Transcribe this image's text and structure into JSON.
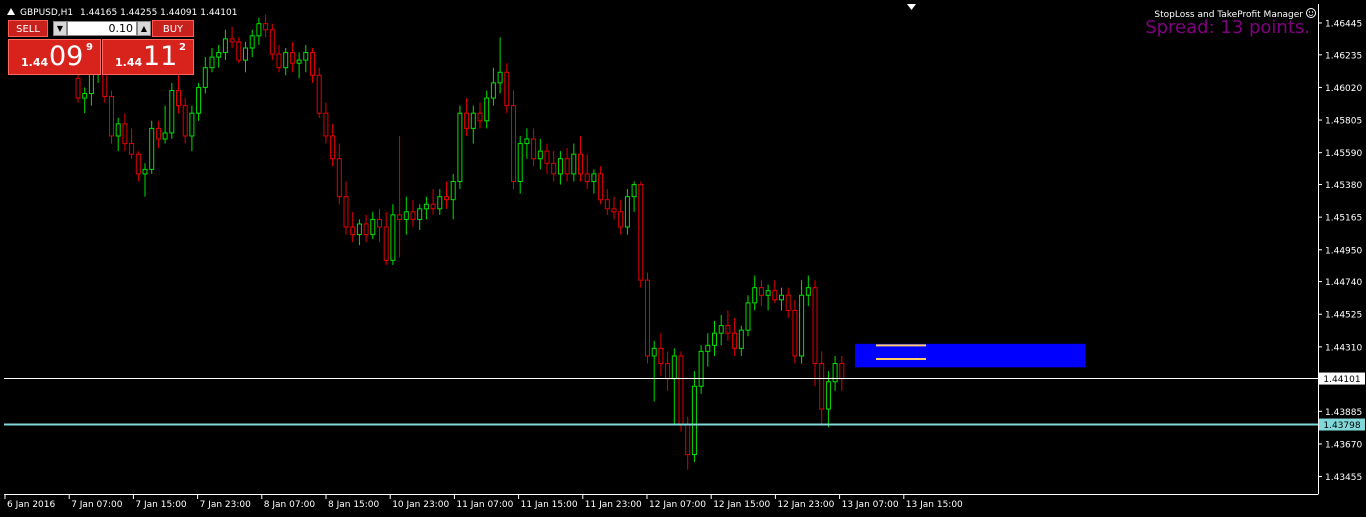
{
  "chart_header": {
    "symbol_tf": "GBPUSD,H1",
    "ohlc": "1.44165 1.44255 1.44091 1.44101",
    "collapse_icon": "triangle-up-icon",
    "shift_marker_icon": "triangle-down-icon"
  },
  "trade_panel": {
    "sell_label": "SELL",
    "buy_label": "BUY",
    "lot_value": "0.10",
    "lot_down_icon": "arrow-down-icon",
    "lot_up_icon": "arrow-up-icon",
    "sell_price_prefix": "1.44",
    "sell_price_big": "09",
    "sell_price_sup": "9",
    "buy_price_prefix": "1.44",
    "buy_price_big": "11",
    "buy_price_sup": "2"
  },
  "indicator": {
    "name": "StopLoss and TakeProfit Manager",
    "smiley_icon": "smiley-icon",
    "spread_text": "Spread: 13 points."
  },
  "price_axis": {
    "ticks": [
      "1.46445",
      "1.46235",
      "1.46020",
      "1.45805",
      "1.45590",
      "1.45380",
      "1.45165",
      "1.44950",
      "1.44740",
      "1.44525",
      "1.44310",
      "1.43885",
      "1.43670",
      "1.43455"
    ],
    "current_price_label": "1.44101",
    "line_price_label": "1.43798"
  },
  "time_axis": {
    "labels": [
      "6 Jan 2016",
      "7 Jan 07:00",
      "7 Jan 15:00",
      "7 Jan 23:00",
      "8 Jan 07:00",
      "8 Jan 15:00",
      "10 Jan 23:00",
      "11 Jan 07:00",
      "11 Jan 15:00",
      "11 Jan 23:00",
      "12 Jan 07:00",
      "12 Jan 15:00",
      "12 Jan 23:00",
      "13 Jan 07:00",
      "13 Jan 15:00"
    ]
  },
  "colors": {
    "background": "#000000",
    "bull": "#00e000",
    "bear": "#e00000",
    "axis": "#ffffff",
    "bid_line": "#ffffff",
    "level_line": "#80d8d8",
    "zone": "#0000ff",
    "sltp_line": "#ffcc66",
    "spread_text": "#800080"
  },
  "chart_data": {
    "type": "candlestick",
    "ylim": [
      1.4334,
      1.4657
    ],
    "zone": {
      "top": 1.4433,
      "bottom": 1.44175
    },
    "sltp_levels": [
      1.4432,
      1.4423
    ],
    "bid_line": 1.44101,
    "level_line": 1.43798,
    "candles": [
      [
        1.4608,
        1.4612,
        1.4592,
        1.4595
      ],
      [
        1.4595,
        1.4602,
        1.4585,
        1.4598
      ],
      [
        1.4598,
        1.462,
        1.459,
        1.4612
      ],
      [
        1.4612,
        1.4625,
        1.4605,
        1.4618
      ],
      [
        1.4618,
        1.463,
        1.4592,
        1.4596
      ],
      [
        1.4596,
        1.46,
        1.4565,
        1.457
      ],
      [
        1.457,
        1.4582,
        1.456,
        1.4578
      ],
      [
        1.4578,
        1.4585,
        1.456,
        1.4565
      ],
      [
        1.4565,
        1.4575,
        1.4555,
        1.4558
      ],
      [
        1.4558,
        1.456,
        1.454,
        1.4545
      ],
      [
        1.4545,
        1.4552,
        1.453,
        1.4548
      ],
      [
        1.4548,
        1.458,
        1.4545,
        1.4575
      ],
      [
        1.4575,
        1.458,
        1.4562,
        1.4568
      ],
      [
        1.4568,
        1.459,
        1.4565,
        1.4572
      ],
      [
        1.4572,
        1.4605,
        1.4568,
        1.46
      ],
      [
        1.46,
        1.462,
        1.4585,
        1.459
      ],
      [
        1.459,
        1.4595,
        1.4565,
        1.457
      ],
      [
        1.457,
        1.459,
        1.456,
        1.4585
      ],
      [
        1.4585,
        1.4605,
        1.458,
        1.4602
      ],
      [
        1.4602,
        1.4622,
        1.4598,
        1.4615
      ],
      [
        1.4615,
        1.4628,
        1.4612,
        1.4622
      ],
      [
        1.4622,
        1.463,
        1.4615,
        1.4625
      ],
      [
        1.4625,
        1.464,
        1.462,
        1.4634
      ],
      [
        1.4634,
        1.4642,
        1.4628,
        1.4632
      ],
      [
        1.4632,
        1.4635,
        1.4618,
        1.462
      ],
      [
        1.462,
        1.4632,
        1.4612,
        1.4628
      ],
      [
        1.4628,
        1.464,
        1.4622,
        1.4636
      ],
      [
        1.4636,
        1.4648,
        1.463,
        1.4644
      ],
      [
        1.4644,
        1.465,
        1.4635,
        1.464
      ],
      [
        1.464,
        1.4644,
        1.462,
        1.4624
      ],
      [
        1.4624,
        1.463,
        1.4612,
        1.4615
      ],
      [
        1.4615,
        1.4628,
        1.461,
        1.4625
      ],
      [
        1.4625,
        1.4632,
        1.4612,
        1.4618
      ],
      [
        1.4618,
        1.4625,
        1.4608,
        1.462
      ],
      [
        1.462,
        1.463,
        1.4612,
        1.4625
      ],
      [
        1.4625,
        1.4628,
        1.4605,
        1.461
      ],
      [
        1.461,
        1.4615,
        1.4582,
        1.4585
      ],
      [
        1.4585,
        1.4592,
        1.4565,
        1.457
      ],
      [
        1.457,
        1.4578,
        1.455,
        1.4555
      ],
      [
        1.4555,
        1.4565,
        1.4525,
        1.453
      ],
      [
        1.453,
        1.454,
        1.4505,
        1.451
      ],
      [
        1.451,
        1.452,
        1.45,
        1.4505
      ],
      [
        1.4505,
        1.4515,
        1.4498,
        1.4512
      ],
      [
        1.4512,
        1.4518,
        1.45,
        1.4505
      ],
      [
        1.4505,
        1.452,
        1.4502,
        1.4515
      ],
      [
        1.4515,
        1.4522,
        1.45,
        1.451
      ],
      [
        1.451,
        1.452,
        1.4485,
        1.4488
      ],
      [
        1.4488,
        1.4525,
        1.4485,
        1.4518
      ],
      [
        1.4518,
        1.457,
        1.449,
        1.4515
      ],
      [
        1.4515,
        1.453,
        1.4505,
        1.452
      ],
      [
        1.452,
        1.4528,
        1.451,
        1.4515
      ],
      [
        1.4515,
        1.4525,
        1.4508,
        1.4522
      ],
      [
        1.4522,
        1.453,
        1.4515,
        1.4525
      ],
      [
        1.4525,
        1.4535,
        1.4518,
        1.4522
      ],
      [
        1.4522,
        1.4535,
        1.4518,
        1.453
      ],
      [
        1.453,
        1.454,
        1.4522,
        1.4528
      ],
      [
        1.4528,
        1.4545,
        1.4515,
        1.454
      ],
      [
        1.454,
        1.459,
        1.4535,
        1.4585
      ],
      [
        1.4585,
        1.4595,
        1.457,
        1.4575
      ],
      [
        1.4575,
        1.459,
        1.4565,
        1.4585
      ],
      [
        1.4585,
        1.4592,
        1.4575,
        1.458
      ],
      [
        1.458,
        1.46,
        1.4575,
        1.4595
      ],
      [
        1.4595,
        1.4615,
        1.459,
        1.4605
      ],
      [
        1.4605,
        1.4635,
        1.4598,
        1.4612
      ],
      [
        1.4612,
        1.4618,
        1.4585,
        1.459
      ],
      [
        1.459,
        1.46,
        1.4535,
        1.454
      ],
      [
        1.454,
        1.457,
        1.4532,
        1.4565
      ],
      [
        1.4565,
        1.4575,
        1.4555,
        1.4568
      ],
      [
        1.4568,
        1.4575,
        1.455,
        1.4555
      ],
      [
        1.4555,
        1.4568,
        1.4548,
        1.456
      ],
      [
        1.456,
        1.4565,
        1.4545,
        1.4552
      ],
      [
        1.4552,
        1.456,
        1.454,
        1.4545
      ],
      [
        1.4545,
        1.456,
        1.4538,
        1.4555
      ],
      [
        1.4555,
        1.4562,
        1.454,
        1.4545
      ],
      [
        1.4545,
        1.4565,
        1.454,
        1.4558
      ],
      [
        1.4558,
        1.457,
        1.454,
        1.4545
      ],
      [
        1.4545,
        1.4558,
        1.4535,
        1.454
      ],
      [
        1.454,
        1.4548,
        1.4532,
        1.4545
      ],
      [
        1.4545,
        1.455,
        1.4525,
        1.4528
      ],
      [
        1.4528,
        1.4535,
        1.4518,
        1.4522
      ],
      [
        1.4522,
        1.453,
        1.4515,
        1.452
      ],
      [
        1.452,
        1.4528,
        1.4505,
        1.451
      ],
      [
        1.451,
        1.4535,
        1.4505,
        1.453
      ],
      [
        1.453,
        1.454,
        1.452,
        1.4538
      ],
      [
        1.4538,
        1.454,
        1.447,
        1.4475
      ],
      [
        1.4475,
        1.448,
        1.442,
        1.4425
      ],
      [
        1.4425,
        1.4435,
        1.4395,
        1.443
      ],
      [
        1.443,
        1.444,
        1.4412,
        1.442
      ],
      [
        1.442,
        1.4428,
        1.4402,
        1.441
      ],
      [
        1.441,
        1.443,
        1.438,
        1.4425
      ],
      [
        1.4425,
        1.4428,
        1.4375,
        1.438
      ],
      [
        1.438,
        1.4385,
        1.435,
        1.436
      ],
      [
        1.436,
        1.4415,
        1.4355,
        1.4405
      ],
      [
        1.4405,
        1.4432,
        1.44,
        1.4428
      ],
      [
        1.4428,
        1.444,
        1.4418,
        1.4432
      ],
      [
        1.4432,
        1.4448,
        1.4425,
        1.444
      ],
      [
        1.444,
        1.4452,
        1.4432,
        1.4445
      ],
      [
        1.4445,
        1.4455,
        1.4435,
        1.444
      ],
      [
        1.444,
        1.445,
        1.4425,
        1.443
      ],
      [
        1.443,
        1.4445,
        1.4425,
        1.4442
      ],
      [
        1.4442,
        1.4465,
        1.4438,
        1.446
      ],
      [
        1.446,
        1.4478,
        1.4455,
        1.447
      ],
      [
        1.447,
        1.4475,
        1.4458,
        1.4465
      ],
      [
        1.4465,
        1.4472,
        1.4455,
        1.4468
      ],
      [
        1.4468,
        1.4475,
        1.446,
        1.4462
      ],
      [
        1.4462,
        1.447,
        1.4455,
        1.4465
      ],
      [
        1.4465,
        1.447,
        1.445,
        1.4455
      ],
      [
        1.4455,
        1.4462,
        1.442,
        1.4425
      ],
      [
        1.4425,
        1.4475,
        1.442,
        1.4465
      ],
      [
        1.4465,
        1.4478,
        1.4458,
        1.447
      ],
      [
        1.447,
        1.4475,
        1.4405,
        1.442
      ],
      [
        1.442,
        1.4428,
        1.438,
        1.439
      ],
      [
        1.439,
        1.4415,
        1.4378,
        1.4408
      ],
      [
        1.4408,
        1.4425,
        1.4402,
        1.442
      ],
      [
        1.442,
        1.4425,
        1.4402,
        1.441
      ]
    ]
  }
}
